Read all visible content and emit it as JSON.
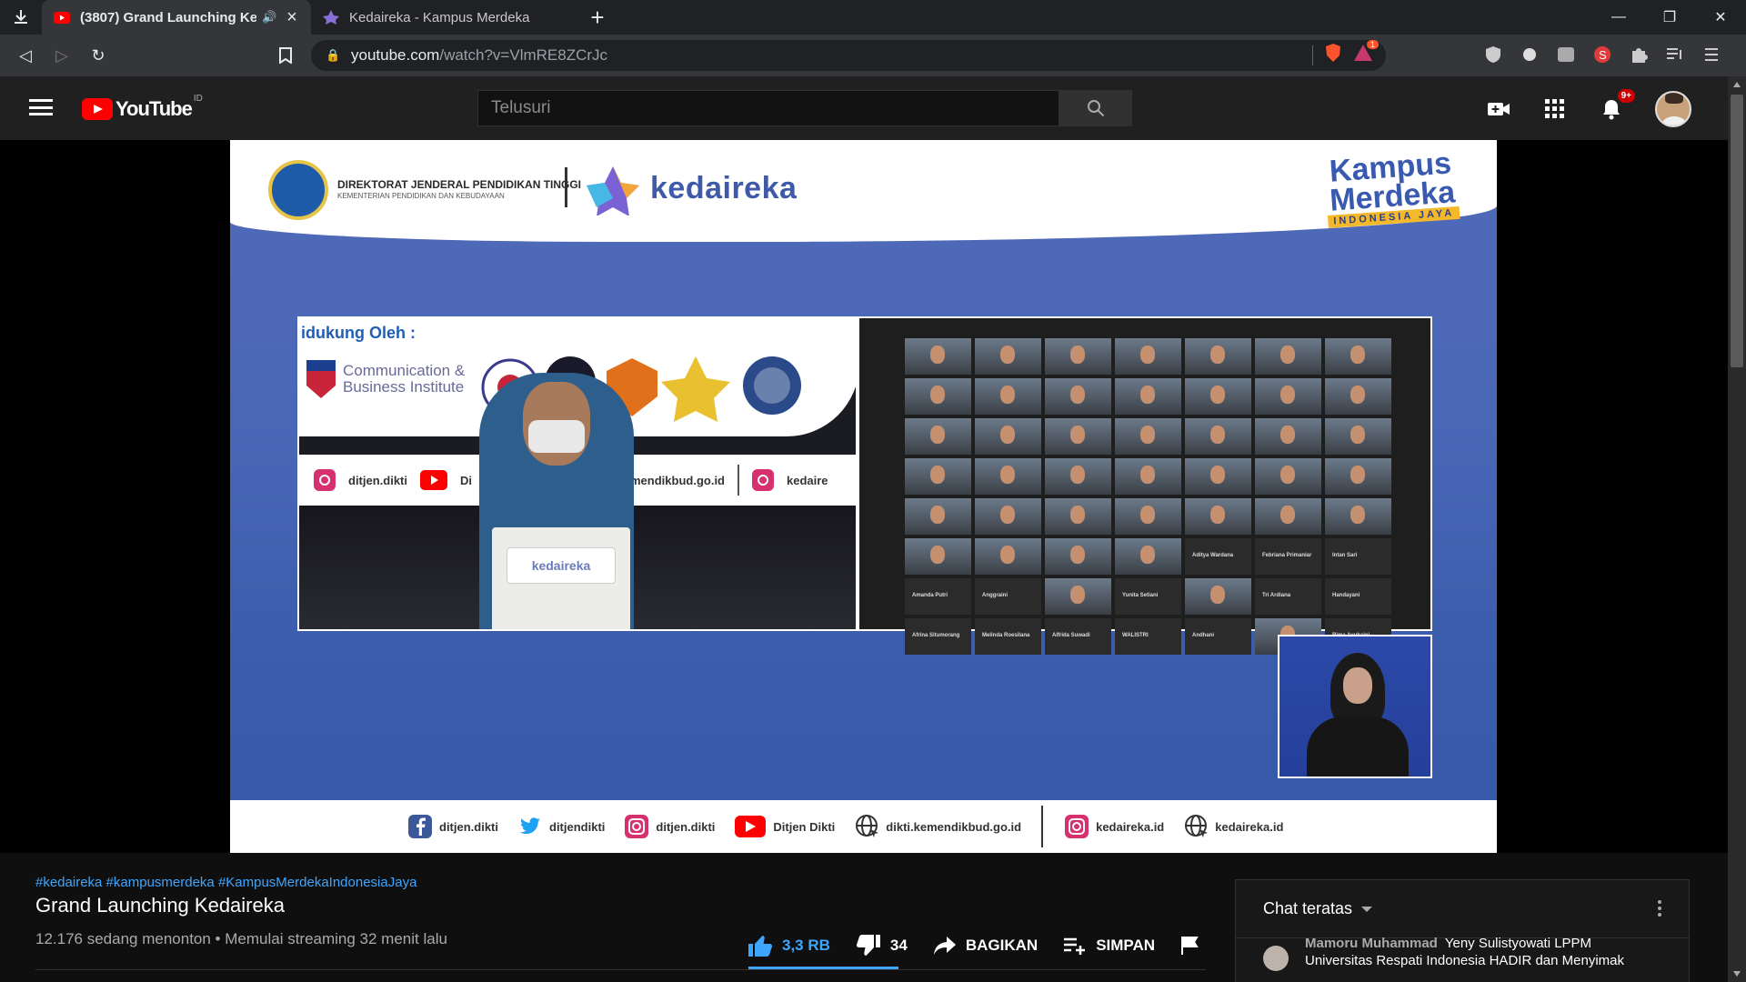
{
  "browser": {
    "tabs": [
      {
        "title": "(3807) Grand Launching Kedaireka",
        "active": true
      },
      {
        "title": "Kedaireka - Kampus Merdeka",
        "active": false
      }
    ],
    "url_host": "youtube.com",
    "url_path": "/watch?v=VlmRE8ZCrJc",
    "brave_badge": "1"
  },
  "youtube": {
    "logo_text": "YouTube",
    "country_code": "ID",
    "search_placeholder": "Telusuri",
    "notification_count": "9+"
  },
  "video_frame": {
    "dikti_line1": "DIREKTORAT JENDERAL PENDIDIKAN TINGGI",
    "dikti_line2": "KEMENTERIAN PENDIDIKAN DAN KEBUDAYAAN",
    "brand": "kedaireka",
    "kampus_line1": "Kampus",
    "kampus_line2": "Merdeka",
    "kampus_line3": "INDONESIA JAYA",
    "supported_by": "idukung Oleh :",
    "sponsor_name_line1": "Communication &",
    "sponsor_name_line2": "Business Institute",
    "inner_social": [
      "ditjen.dikti",
      "Di",
      "mendikbud.go.id",
      "kedaire"
    ],
    "podium_label": "kedaireka",
    "zoom_names": [
      "",
      "",
      "",
      "",
      "",
      "",
      "",
      "",
      "",
      "",
      "",
      "",
      "",
      "",
      "",
      "",
      "",
      "",
      "",
      "",
      "",
      "",
      "",
      "",
      "",
      "",
      "",
      "",
      "",
      "",
      "",
      "",
      "",
      "",
      "",
      "",
      "",
      "",
      "",
      "Aditya Wardana",
      "Febriana Primaniar",
      "Intan Sari",
      "Amanda Putri",
      "Anggraini",
      "",
      "Yunita Setiani",
      "",
      "Tri Ardiana",
      "Handayani",
      "Afrina Situmorang",
      "Melinda Roesilana",
      "Alfrida Suwadi",
      "WALISTRI",
      "Andhani",
      "",
      "Rima Ayuhaini"
    ],
    "footer_social": [
      {
        "platform": "facebook-icon",
        "label": "ditjen.dikti"
      },
      {
        "platform": "twitter-icon",
        "label": "ditjendikti"
      },
      {
        "platform": "instagram-icon",
        "label": "ditjen.dikti"
      },
      {
        "platform": "youtube-icon",
        "label": "Ditjen Dikti"
      },
      {
        "platform": "web-icon",
        "label": "dikti.kemendikbud.go.id"
      }
    ],
    "footer_social_right": [
      {
        "platform": "instagram-icon",
        "label": "kedaireka.id"
      },
      {
        "platform": "web-icon",
        "label": "kedaireka.id"
      }
    ]
  },
  "video": {
    "hashtags": "#kedaireka #kampusmerdeka #KampusMerdekaIndonesiaJaya",
    "title": "Grand Launching Kedaireka",
    "meta": "12.176 sedang menonton • Memulai streaming 32 menit lalu",
    "likes": "3,3 RB",
    "dislikes": "34",
    "share_label": "BAGIKAN",
    "save_label": "SIMPAN"
  },
  "chat": {
    "header": "Chat teratas",
    "message_author": "Mamoru Muhammad",
    "message_text": "Yeny Sulistyowati LPPM Universitas Respati Indonesia HADIR dan Menyimak"
  },
  "colors": {
    "yt_red": "#ff0000",
    "link_blue": "#3ea6ff",
    "frame_blue": "#4a67b6"
  }
}
